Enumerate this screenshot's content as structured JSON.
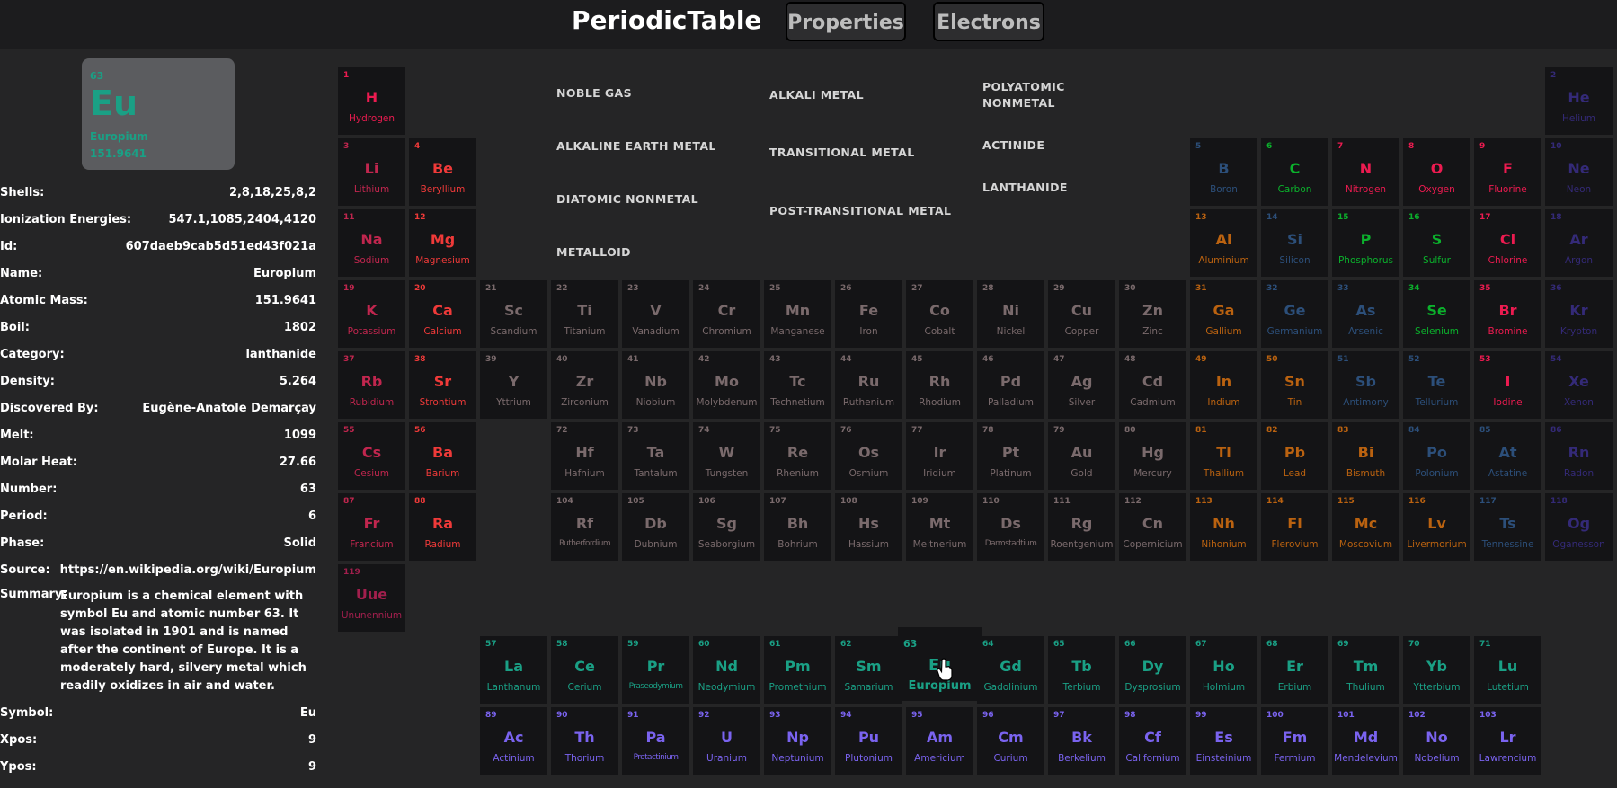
{
  "header": {
    "title": "PeriodicTable",
    "nav": [
      "Properties",
      "Electrons"
    ]
  },
  "colors": {
    "noble": "#342a78",
    "alkali": "#c0264e",
    "polyatomic": "#0bb12c",
    "alkaline": "#ef3a39",
    "transitional": "#7a6a6c",
    "actinide": "#7a63ef",
    "diatomic": "#ec1b50",
    "post": "#ba6210",
    "lanthanide": "#1aa085",
    "metalloid": "#2c4f7a",
    "unknown": "#a21f4d"
  },
  "selected": {
    "number": "63",
    "symbol": "Eu",
    "name": "Europium",
    "atomic_mass": "151.9641"
  },
  "details": [
    {
      "key": "Shells:",
      "value": "2,8,18,25,8,2"
    },
    {
      "key": "Ionization Energies:",
      "value": "547.1,1085,2404,4120"
    },
    {
      "key": "Id:",
      "value": "607daeb9cab5d51ed43f021a"
    },
    {
      "key": "Name:",
      "value": "Europium"
    },
    {
      "key": "Atomic Mass:",
      "value": "151.9641"
    },
    {
      "key": "Boil:",
      "value": "1802"
    },
    {
      "key": "Category:",
      "value": "lanthanide"
    },
    {
      "key": "Density:",
      "value": "5.264"
    },
    {
      "key": "Discovered By:",
      "value": "Eugène-Anatole Demarçay"
    },
    {
      "key": "Melt:",
      "value": "1099"
    },
    {
      "key": "Molar Heat:",
      "value": "27.66"
    },
    {
      "key": "Number:",
      "value": "63"
    },
    {
      "key": "Period:",
      "value": "6"
    },
    {
      "key": "Phase:",
      "value": "Solid"
    },
    {
      "key": "Source:",
      "value": "https://en.wikipedia.org/wiki/Europium"
    }
  ],
  "summary_label": "Summary:",
  "summary": "Europium is a chemical element with symbol Eu and atomic number 63. It was isolated in 1901 and is named after the continent of Europe. It is a moderately hard, silvery metal which readily oxidizes in air and water.",
  "details_tail": [
    {
      "key": "Symbol:",
      "value": "Eu"
    },
    {
      "key": "Xpos:",
      "value": "9"
    },
    {
      "key": "Ypos:",
      "value": "9"
    }
  ],
  "legend": [
    "NOBLE GAS",
    "ALKALINE EARTH METAL",
    "DIATOMIC NONMETAL",
    "METALLOID",
    "ALKALI METAL",
    "TRANSITIONAL METAL",
    "POST-TRANSITIONAL METAL",
    "POLYATOMIC NONMETAL",
    "ACTINIDE",
    "LANTHANIDE"
  ],
  "elements": [
    {
      "n": "1",
      "s": "H",
      "name": "Hydrogen",
      "x": 1,
      "y": 1,
      "c": "diatomic"
    },
    {
      "n": "2",
      "s": "He",
      "name": "Helium",
      "x": 18,
      "y": 1,
      "c": "noble"
    },
    {
      "n": "3",
      "s": "Li",
      "name": "Lithium",
      "x": 1,
      "y": 2,
      "c": "alkali"
    },
    {
      "n": "4",
      "s": "Be",
      "name": "Beryllium",
      "x": 2,
      "y": 2,
      "c": "alkaline"
    },
    {
      "n": "5",
      "s": "B",
      "name": "Boron",
      "x": 13,
      "y": 2,
      "c": "metalloid"
    },
    {
      "n": "6",
      "s": "C",
      "name": "Carbon",
      "x": 14,
      "y": 2,
      "c": "polyatomic"
    },
    {
      "n": "7",
      "s": "N",
      "name": "Nitrogen",
      "x": 15,
      "y": 2,
      "c": "diatomic"
    },
    {
      "n": "8",
      "s": "O",
      "name": "Oxygen",
      "x": 16,
      "y": 2,
      "c": "diatomic"
    },
    {
      "n": "9",
      "s": "F",
      "name": "Fluorine",
      "x": 17,
      "y": 2,
      "c": "diatomic"
    },
    {
      "n": "10",
      "s": "Ne",
      "name": "Neon",
      "x": 18,
      "y": 2,
      "c": "noble"
    },
    {
      "n": "11",
      "s": "Na",
      "name": "Sodium",
      "x": 1,
      "y": 3,
      "c": "alkali"
    },
    {
      "n": "12",
      "s": "Mg",
      "name": "Magnesium",
      "x": 2,
      "y": 3,
      "c": "alkaline"
    },
    {
      "n": "13",
      "s": "Al",
      "name": "Aluminium",
      "x": 13,
      "y": 3,
      "c": "post"
    },
    {
      "n": "14",
      "s": "Si",
      "name": "Silicon",
      "x": 14,
      "y": 3,
      "c": "metalloid"
    },
    {
      "n": "15",
      "s": "P",
      "name": "Phosphorus",
      "x": 15,
      "y": 3,
      "c": "polyatomic"
    },
    {
      "n": "16",
      "s": "S",
      "name": "Sulfur",
      "x": 16,
      "y": 3,
      "c": "polyatomic"
    },
    {
      "n": "17",
      "s": "Cl",
      "name": "Chlorine",
      "x": 17,
      "y": 3,
      "c": "diatomic"
    },
    {
      "n": "18",
      "s": "Ar",
      "name": "Argon",
      "x": 18,
      "y": 3,
      "c": "noble"
    },
    {
      "n": "19",
      "s": "K",
      "name": "Potassium",
      "x": 1,
      "y": 4,
      "c": "alkali"
    },
    {
      "n": "20",
      "s": "Ca",
      "name": "Calcium",
      "x": 2,
      "y": 4,
      "c": "alkaline"
    },
    {
      "n": "21",
      "s": "Sc",
      "name": "Scandium",
      "x": 3,
      "y": 4,
      "c": "transitional"
    },
    {
      "n": "22",
      "s": "Ti",
      "name": "Titanium",
      "x": 4,
      "y": 4,
      "c": "transitional"
    },
    {
      "n": "23",
      "s": "V",
      "name": "Vanadium",
      "x": 5,
      "y": 4,
      "c": "transitional"
    },
    {
      "n": "24",
      "s": "Cr",
      "name": "Chromium",
      "x": 6,
      "y": 4,
      "c": "transitional"
    },
    {
      "n": "25",
      "s": "Mn",
      "name": "Manganese",
      "x": 7,
      "y": 4,
      "c": "transitional"
    },
    {
      "n": "26",
      "s": "Fe",
      "name": "Iron",
      "x": 8,
      "y": 4,
      "c": "transitional"
    },
    {
      "n": "27",
      "s": "Co",
      "name": "Cobalt",
      "x": 9,
      "y": 4,
      "c": "transitional"
    },
    {
      "n": "28",
      "s": "Ni",
      "name": "Nickel",
      "x": 10,
      "y": 4,
      "c": "transitional"
    },
    {
      "n": "29",
      "s": "Cu",
      "name": "Copper",
      "x": 11,
      "y": 4,
      "c": "transitional"
    },
    {
      "n": "30",
      "s": "Zn",
      "name": "Zinc",
      "x": 12,
      "y": 4,
      "c": "transitional"
    },
    {
      "n": "31",
      "s": "Ga",
      "name": "Gallium",
      "x": 13,
      "y": 4,
      "c": "post"
    },
    {
      "n": "32",
      "s": "Ge",
      "name": "Germanium",
      "x": 14,
      "y": 4,
      "c": "metalloid"
    },
    {
      "n": "33",
      "s": "As",
      "name": "Arsenic",
      "x": 15,
      "y": 4,
      "c": "metalloid"
    },
    {
      "n": "34",
      "s": "Se",
      "name": "Selenium",
      "x": 16,
      "y": 4,
      "c": "polyatomic"
    },
    {
      "n": "35",
      "s": "Br",
      "name": "Bromine",
      "x": 17,
      "y": 4,
      "c": "diatomic"
    },
    {
      "n": "36",
      "s": "Kr",
      "name": "Krypton",
      "x": 18,
      "y": 4,
      "c": "noble"
    },
    {
      "n": "37",
      "s": "Rb",
      "name": "Rubidium",
      "x": 1,
      "y": 5,
      "c": "alkali"
    },
    {
      "n": "38",
      "s": "Sr",
      "name": "Strontium",
      "x": 2,
      "y": 5,
      "c": "alkaline"
    },
    {
      "n": "39",
      "s": "Y",
      "name": "Yttrium",
      "x": 3,
      "y": 5,
      "c": "transitional"
    },
    {
      "n": "40",
      "s": "Zr",
      "name": "Zirconium",
      "x": 4,
      "y": 5,
      "c": "transitional"
    },
    {
      "n": "41",
      "s": "Nb",
      "name": "Niobium",
      "x": 5,
      "y": 5,
      "c": "transitional"
    },
    {
      "n": "42",
      "s": "Mo",
      "name": "Molybdenum",
      "x": 6,
      "y": 5,
      "c": "transitional"
    },
    {
      "n": "43",
      "s": "Tc",
      "name": "Technetium",
      "x": 7,
      "y": 5,
      "c": "transitional"
    },
    {
      "n": "44",
      "s": "Ru",
      "name": "Ruthenium",
      "x": 8,
      "y": 5,
      "c": "transitional"
    },
    {
      "n": "45",
      "s": "Rh",
      "name": "Rhodium",
      "x": 9,
      "y": 5,
      "c": "transitional"
    },
    {
      "n": "46",
      "s": "Pd",
      "name": "Palladium",
      "x": 10,
      "y": 5,
      "c": "transitional"
    },
    {
      "n": "47",
      "s": "Ag",
      "name": "Silver",
      "x": 11,
      "y": 5,
      "c": "transitional"
    },
    {
      "n": "48",
      "s": "Cd",
      "name": "Cadmium",
      "x": 12,
      "y": 5,
      "c": "transitional"
    },
    {
      "n": "49",
      "s": "In",
      "name": "Indium",
      "x": 13,
      "y": 5,
      "c": "post"
    },
    {
      "n": "50",
      "s": "Sn",
      "name": "Tin",
      "x": 14,
      "y": 5,
      "c": "post"
    },
    {
      "n": "51",
      "s": "Sb",
      "name": "Antimony",
      "x": 15,
      "y": 5,
      "c": "metalloid"
    },
    {
      "n": "52",
      "s": "Te",
      "name": "Tellurium",
      "x": 16,
      "y": 5,
      "c": "metalloid"
    },
    {
      "n": "53",
      "s": "I",
      "name": "Iodine",
      "x": 17,
      "y": 5,
      "c": "diatomic"
    },
    {
      "n": "54",
      "s": "Xe",
      "name": "Xenon",
      "x": 18,
      "y": 5,
      "c": "noble"
    },
    {
      "n": "55",
      "s": "Cs",
      "name": "Cesium",
      "x": 1,
      "y": 6,
      "c": "alkali"
    },
    {
      "n": "56",
      "s": "Ba",
      "name": "Barium",
      "x": 2,
      "y": 6,
      "c": "alkaline"
    },
    {
      "n": "72",
      "s": "Hf",
      "name": "Hafnium",
      "x": 4,
      "y": 6,
      "c": "transitional"
    },
    {
      "n": "73",
      "s": "Ta",
      "name": "Tantalum",
      "x": 5,
      "y": 6,
      "c": "transitional"
    },
    {
      "n": "74",
      "s": "W",
      "name": "Tungsten",
      "x": 6,
      "y": 6,
      "c": "transitional"
    },
    {
      "n": "75",
      "s": "Re",
      "name": "Rhenium",
      "x": 7,
      "y": 6,
      "c": "transitional"
    },
    {
      "n": "76",
      "s": "Os",
      "name": "Osmium",
      "x": 8,
      "y": 6,
      "c": "transitional"
    },
    {
      "n": "77",
      "s": "Ir",
      "name": "Iridium",
      "x": 9,
      "y": 6,
      "c": "transitional"
    },
    {
      "n": "78",
      "s": "Pt",
      "name": "Platinum",
      "x": 10,
      "y": 6,
      "c": "transitional"
    },
    {
      "n": "79",
      "s": "Au",
      "name": "Gold",
      "x": 11,
      "y": 6,
      "c": "transitional"
    },
    {
      "n": "80",
      "s": "Hg",
      "name": "Mercury",
      "x": 12,
      "y": 6,
      "c": "transitional"
    },
    {
      "n": "81",
      "s": "Tl",
      "name": "Thallium",
      "x": 13,
      "y": 6,
      "c": "post"
    },
    {
      "n": "82",
      "s": "Pb",
      "name": "Lead",
      "x": 14,
      "y": 6,
      "c": "post"
    },
    {
      "n": "83",
      "s": "Bi",
      "name": "Bismuth",
      "x": 15,
      "y": 6,
      "c": "post"
    },
    {
      "n": "84",
      "s": "Po",
      "name": "Polonium",
      "x": 16,
      "y": 6,
      "c": "metalloid"
    },
    {
      "n": "85",
      "s": "At",
      "name": "Astatine",
      "x": 17,
      "y": 6,
      "c": "metalloid"
    },
    {
      "n": "86",
      "s": "Rn",
      "name": "Radon",
      "x": 18,
      "y": 6,
      "c": "noble"
    },
    {
      "n": "87",
      "s": "Fr",
      "name": "Francium",
      "x": 1,
      "y": 7,
      "c": "alkali"
    },
    {
      "n": "88",
      "s": "Ra",
      "name": "Radium",
      "x": 2,
      "y": 7,
      "c": "alkaline"
    },
    {
      "n": "104",
      "s": "Rf",
      "name": "Rutherfordium",
      "x": 4,
      "y": 7,
      "c": "transitional"
    },
    {
      "n": "105",
      "s": "Db",
      "name": "Dubnium",
      "x": 5,
      "y": 7,
      "c": "transitional"
    },
    {
      "n": "106",
      "s": "Sg",
      "name": "Seaborgium",
      "x": 6,
      "y": 7,
      "c": "transitional"
    },
    {
      "n": "107",
      "s": "Bh",
      "name": "Bohrium",
      "x": 7,
      "y": 7,
      "c": "transitional"
    },
    {
      "n": "108",
      "s": "Hs",
      "name": "Hassium",
      "x": 8,
      "y": 7,
      "c": "transitional"
    },
    {
      "n": "109",
      "s": "Mt",
      "name": "Meitnerium",
      "x": 9,
      "y": 7,
      "c": "transitional"
    },
    {
      "n": "110",
      "s": "Ds",
      "name": "Darmstadtium",
      "x": 10,
      "y": 7,
      "c": "transitional"
    },
    {
      "n": "111",
      "s": "Rg",
      "name": "Roentgenium",
      "x": 11,
      "y": 7,
      "c": "transitional"
    },
    {
      "n": "112",
      "s": "Cn",
      "name": "Copernicium",
      "x": 12,
      "y": 7,
      "c": "transitional"
    },
    {
      "n": "113",
      "s": "Nh",
      "name": "Nihonium",
      "x": 13,
      "y": 7,
      "c": "post"
    },
    {
      "n": "114",
      "s": "Fl",
      "name": "Flerovium",
      "x": 14,
      "y": 7,
      "c": "post"
    },
    {
      "n": "115",
      "s": "Mc",
      "name": "Moscovium",
      "x": 15,
      "y": 7,
      "c": "post"
    },
    {
      "n": "116",
      "s": "Lv",
      "name": "Livermorium",
      "x": 16,
      "y": 7,
      "c": "post"
    },
    {
      "n": "117",
      "s": "Ts",
      "name": "Tennessine",
      "x": 17,
      "y": 7,
      "c": "metalloid"
    },
    {
      "n": "118",
      "s": "Og",
      "name": "Oganesson",
      "x": 18,
      "y": 7,
      "c": "noble"
    },
    {
      "n": "119",
      "s": "Uue",
      "name": "Ununennium",
      "x": 1,
      "y": 8,
      "c": "unknown"
    },
    {
      "n": "57",
      "s": "La",
      "name": "Lanthanum",
      "x": 3,
      "y": 9,
      "c": "lanthanide"
    },
    {
      "n": "58",
      "s": "Ce",
      "name": "Cerium",
      "x": 4,
      "y": 9,
      "c": "lanthanide"
    },
    {
      "n": "59",
      "s": "Pr",
      "name": "Praseodymium",
      "x": 5,
      "y": 9,
      "c": "lanthanide"
    },
    {
      "n": "60",
      "s": "Nd",
      "name": "Neodymium",
      "x": 6,
      "y": 9,
      "c": "lanthanide"
    },
    {
      "n": "61",
      "s": "Pm",
      "name": "Promethium",
      "x": 7,
      "y": 9,
      "c": "lanthanide"
    },
    {
      "n": "62",
      "s": "Sm",
      "name": "Samarium",
      "x": 8,
      "y": 9,
      "c": "lanthanide"
    },
    {
      "n": "64",
      "s": "Gd",
      "name": "Gadolinium",
      "x": 10,
      "y": 9,
      "c": "lanthanide"
    },
    {
      "n": "65",
      "s": "Tb",
      "name": "Terbium",
      "x": 11,
      "y": 9,
      "c": "lanthanide"
    },
    {
      "n": "66",
      "s": "Dy",
      "name": "Dysprosium",
      "x": 12,
      "y": 9,
      "c": "lanthanide"
    },
    {
      "n": "67",
      "s": "Ho",
      "name": "Holmium",
      "x": 13,
      "y": 9,
      "c": "lanthanide"
    },
    {
      "n": "68",
      "s": "Er",
      "name": "Erbium",
      "x": 14,
      "y": 9,
      "c": "lanthanide"
    },
    {
      "n": "69",
      "s": "Tm",
      "name": "Thulium",
      "x": 15,
      "y": 9,
      "c": "lanthanide"
    },
    {
      "n": "70",
      "s": "Yb",
      "name": "Ytterbium",
      "x": 16,
      "y": 9,
      "c": "lanthanide"
    },
    {
      "n": "71",
      "s": "Lu",
      "name": "Lutetium",
      "x": 17,
      "y": 9,
      "c": "lanthanide"
    },
    {
      "n": "89",
      "s": "Ac",
      "name": "Actinium",
      "x": 3,
      "y": 10,
      "c": "actinide"
    },
    {
      "n": "90",
      "s": "Th",
      "name": "Thorium",
      "x": 4,
      "y": 10,
      "c": "actinide"
    },
    {
      "n": "91",
      "s": "Pa",
      "name": "Protactinium",
      "x": 5,
      "y": 10,
      "c": "actinide"
    },
    {
      "n": "92",
      "s": "U",
      "name": "Uranium",
      "x": 6,
      "y": 10,
      "c": "actinide"
    },
    {
      "n": "93",
      "s": "Np",
      "name": "Neptunium",
      "x": 7,
      "y": 10,
      "c": "actinide"
    },
    {
      "n": "94",
      "s": "Pu",
      "name": "Plutonium",
      "x": 8,
      "y": 10,
      "c": "actinide"
    },
    {
      "n": "95",
      "s": "Am",
      "name": "Americium",
      "x": 9,
      "y": 10,
      "c": "actinide"
    },
    {
      "n": "96",
      "s": "Cm",
      "name": "Curium",
      "x": 10,
      "y": 10,
      "c": "actinide"
    },
    {
      "n": "97",
      "s": "Bk",
      "name": "Berkelium",
      "x": 11,
      "y": 10,
      "c": "actinide"
    },
    {
      "n": "98",
      "s": "Cf",
      "name": "Californium",
      "x": 12,
      "y": 10,
      "c": "actinide"
    },
    {
      "n": "99",
      "s": "Es",
      "name": "Einsteinium",
      "x": 13,
      "y": 10,
      "c": "actinide"
    },
    {
      "n": "100",
      "s": "Fm",
      "name": "Fermium",
      "x": 14,
      "y": 10,
      "c": "actinide"
    },
    {
      "n": "101",
      "s": "Md",
      "name": "Mendelevium",
      "x": 15,
      "y": 10,
      "c": "actinide"
    },
    {
      "n": "102",
      "s": "No",
      "name": "Nobelium",
      "x": 16,
      "y": 10,
      "c": "actinide"
    },
    {
      "n": "103",
      "s": "Lr",
      "name": "Lawrencium",
      "x": 17,
      "y": 10,
      "c": "actinide"
    }
  ]
}
